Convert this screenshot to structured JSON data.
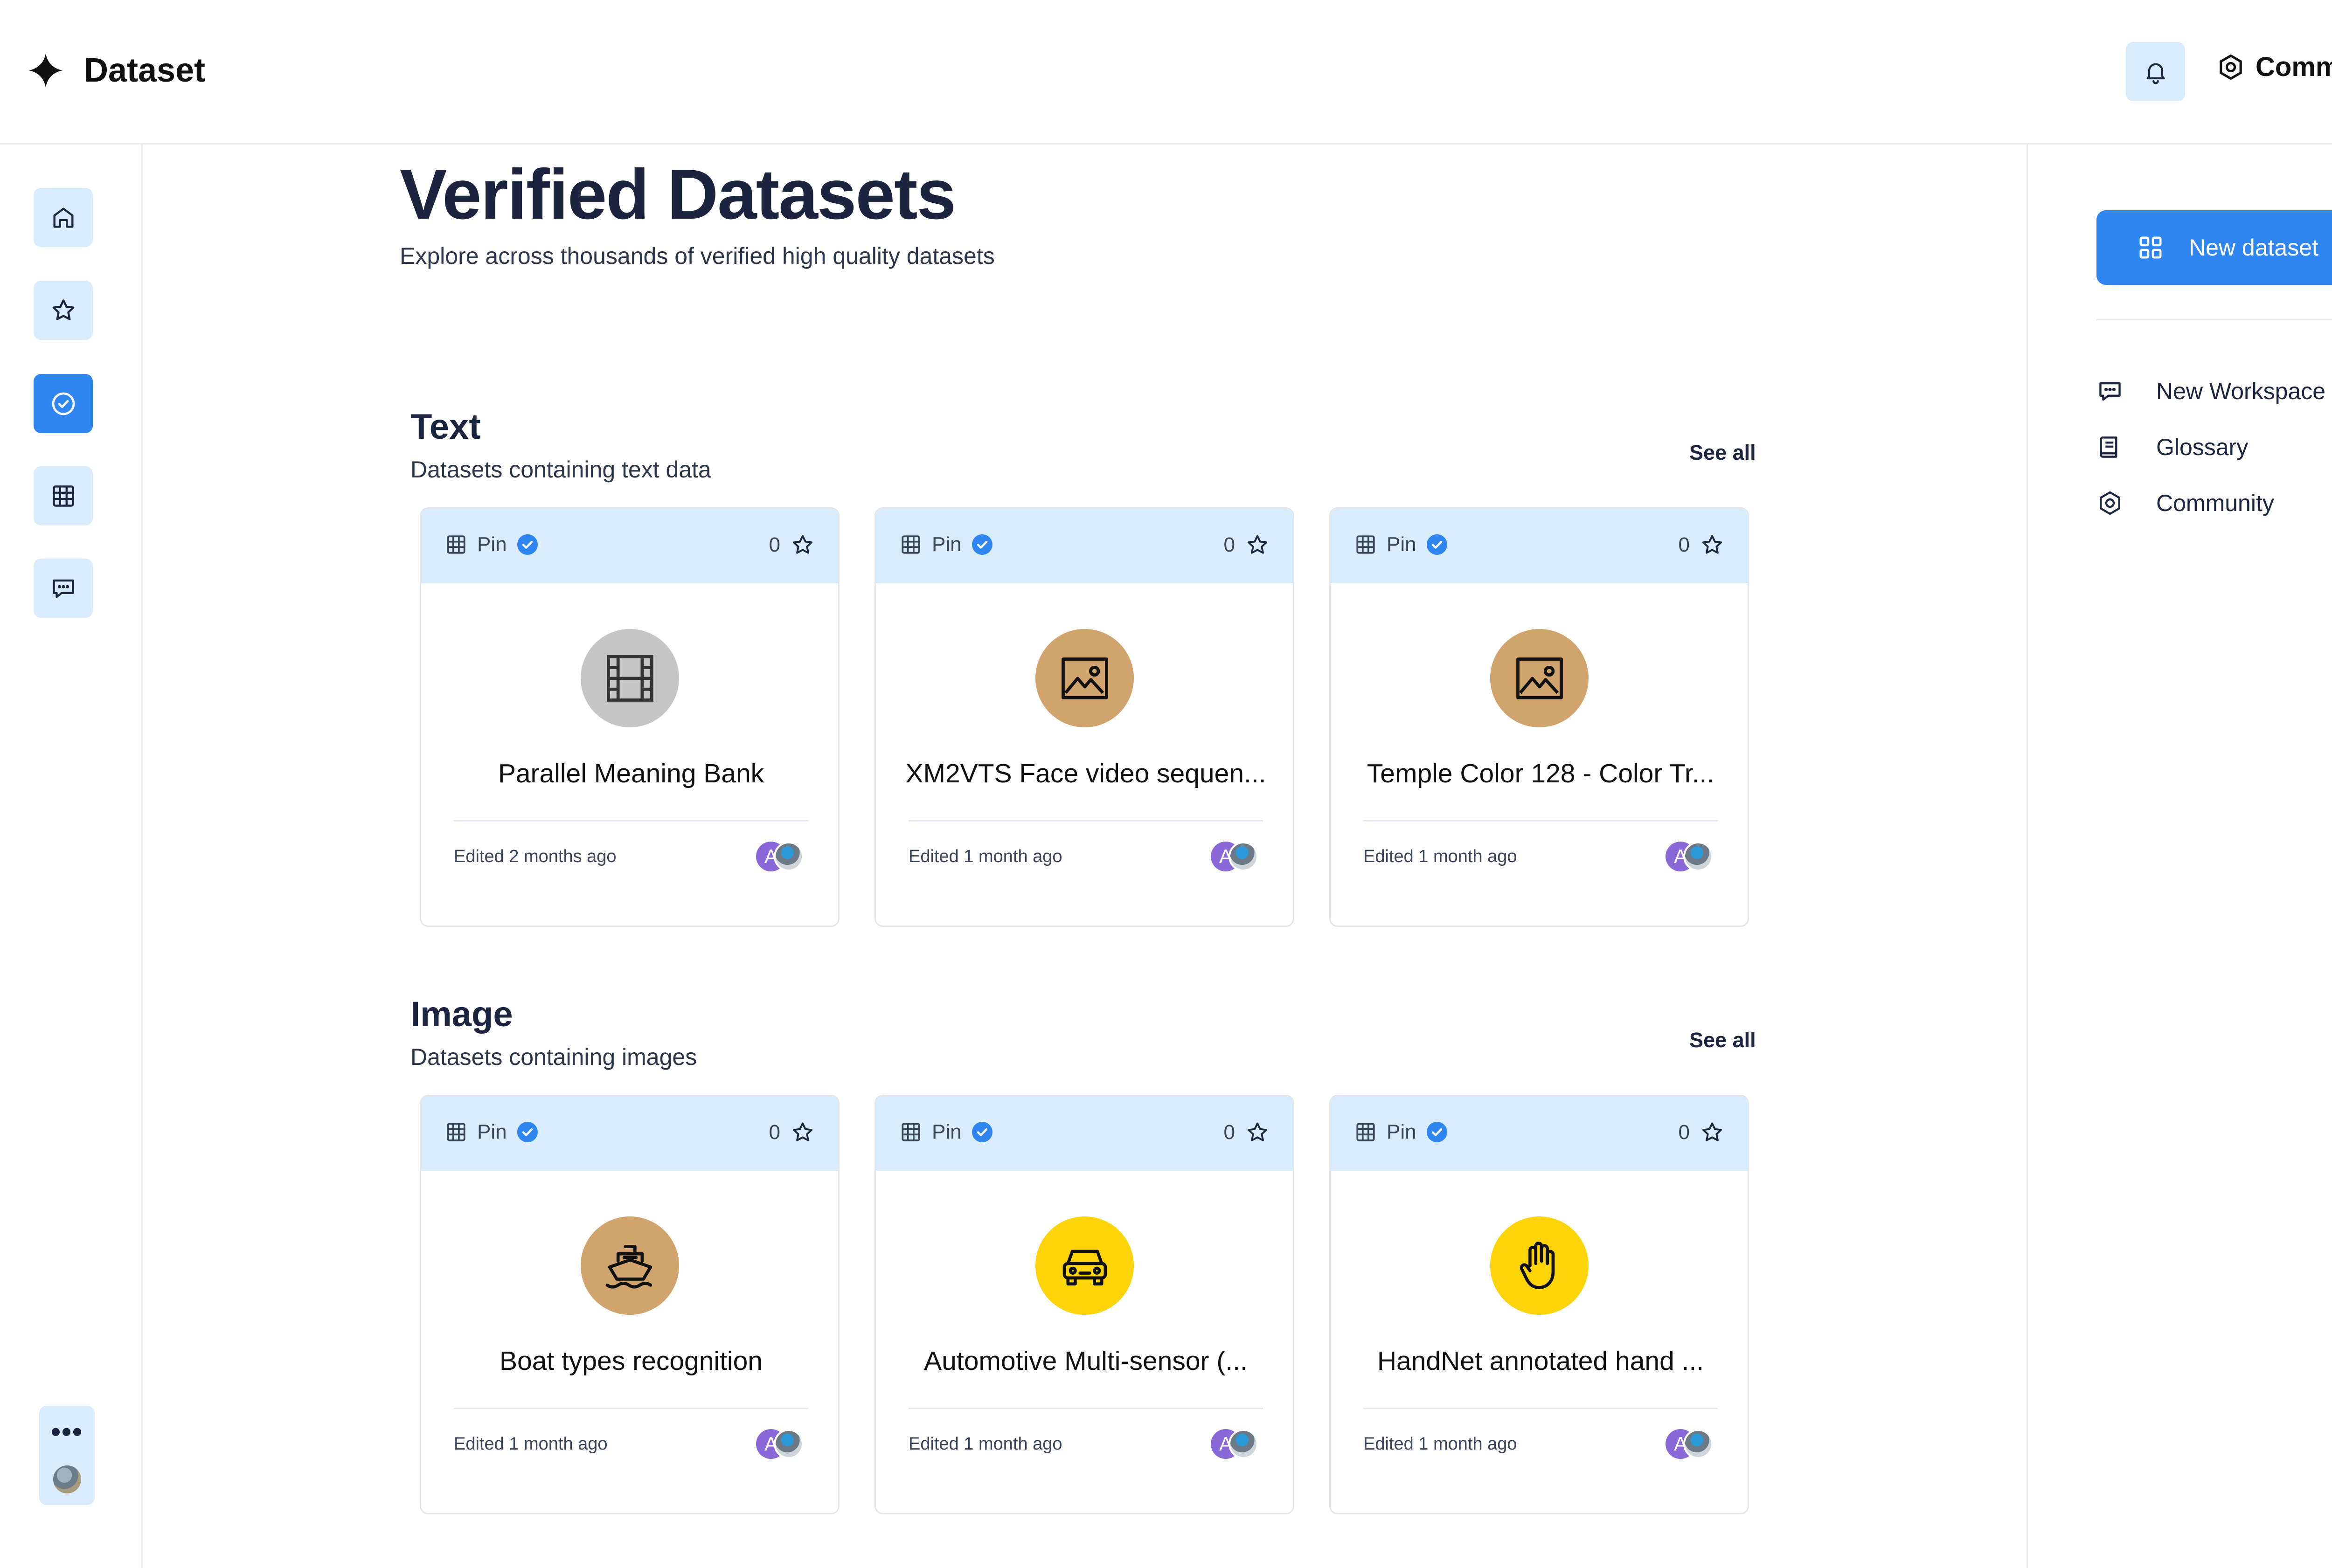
{
  "app": {
    "title": "Dataset"
  },
  "header": {
    "community_label": "Community"
  },
  "page": {
    "title": "Verified Datasets",
    "subtitle": "Explore across thousands of verified high quality datasets"
  },
  "sidebar": {
    "items": [
      {
        "name": "home",
        "icon": "home-icon",
        "active": false
      },
      {
        "name": "favorites",
        "icon": "star-icon",
        "active": false
      },
      {
        "name": "verified",
        "icon": "check-circle-icon",
        "active": true
      },
      {
        "name": "tables",
        "icon": "table-icon",
        "active": false
      },
      {
        "name": "messages",
        "icon": "chat-icon",
        "active": false
      }
    ],
    "more_label": "•••"
  },
  "right_panel": {
    "new_dataset_label": "New dataset",
    "links": [
      {
        "label": "New Workspace",
        "icon": "chat-icon"
      },
      {
        "label": "Glossary",
        "icon": "book-icon"
      },
      {
        "label": "Community",
        "icon": "hexagon-icon"
      }
    ]
  },
  "sections": [
    {
      "title": "Text",
      "subtitle": "Datasets containing text data",
      "see_all": "See all",
      "cards": [
        {
          "pin": "Pin",
          "stars": "0",
          "name": "Parallel Meaning Bank",
          "edited": "Edited 2 months ago",
          "icon": "film-icon",
          "circle_color": "#c6c6c6",
          "avatar_letter": "A"
        },
        {
          "pin": "Pin",
          "stars": "0",
          "name": "XM2VTS Face video sequen...",
          "edited": "Edited 1 month ago",
          "icon": "image-icon",
          "circle_color": "#d1a46e",
          "avatar_letter": "A"
        },
        {
          "pin": "Pin",
          "stars": "0",
          "name": "Temple Color 128 - Color Tr...",
          "edited": "Edited 1 month ago",
          "icon": "image-icon",
          "circle_color": "#d1a46e",
          "avatar_letter": "A"
        }
      ]
    },
    {
      "title": "Image",
      "subtitle": "Datasets containing images",
      "see_all": "See all",
      "cards": [
        {
          "pin": "Pin",
          "stars": "0",
          "name": "Boat types recognition",
          "edited": "Edited 1 month ago",
          "icon": "ship-icon",
          "circle_color": "#d1a46e",
          "avatar_letter": "A"
        },
        {
          "pin": "Pin",
          "stars": "0",
          "name": "Automotive Multi-sensor (...",
          "edited": "Edited 1 month ago",
          "icon": "car-icon",
          "circle_color": "#fcd408",
          "avatar_letter": "A"
        },
        {
          "pin": "Pin",
          "stars": "0",
          "name": "HandNet annotated hand ...",
          "edited": "Edited 1 month ago",
          "icon": "hand-icon",
          "circle_color": "#fcd408",
          "avatar_letter": "A"
        }
      ]
    }
  ]
}
